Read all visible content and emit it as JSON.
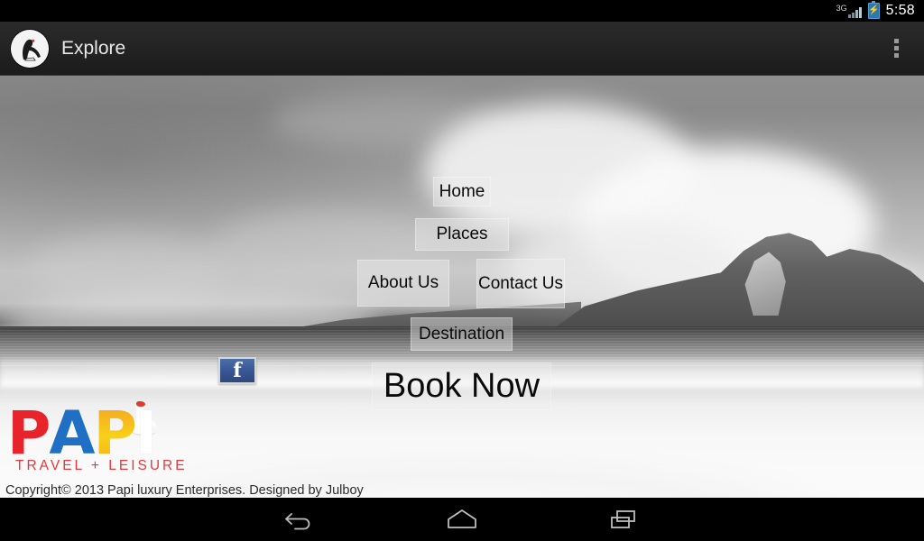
{
  "status_bar": {
    "network_label": "3G",
    "network_icon": "signal-bars-icon",
    "battery_icon": "battery-charging-icon",
    "battery_bolt": "⚡",
    "time": "5:58"
  },
  "action_bar": {
    "app_icon": "pelican-logo-icon",
    "title": "Explore",
    "overflow_icon": "overflow-menu-icon"
  },
  "page": {
    "background_image": "grayscale-beach-photo",
    "pelican_icon": "pelican-bird-icon"
  },
  "nav_buttons": [
    {
      "id": "home",
      "label": "Home"
    },
    {
      "id": "places",
      "label": "Places"
    },
    {
      "id": "about",
      "label": "About Us"
    },
    {
      "id": "contact",
      "label": "Contact Us"
    },
    {
      "id": "destination",
      "label": "Destination"
    },
    {
      "id": "book",
      "label": "Book Now"
    }
  ],
  "logo": {
    "letters": [
      "P",
      "A",
      "P",
      "I"
    ],
    "tagline": "TRAVEL + LEISURE",
    "colors": {
      "p1": "#e8232a",
      "a": "#1f6fc4",
      "p2": "#f5c21a",
      "i": "#ffffff",
      "tagline": "#e8383c"
    }
  },
  "social": {
    "facebook_icon": "facebook-icon",
    "facebook_glyph": "f"
  },
  "footer": {
    "copyright": "Copyright© 2013 Papi luxury Enterprises. Designed by Julboy"
  },
  "system_nav": {
    "back_icon": "back-arrow-icon",
    "home_icon": "home-icon",
    "recents_icon": "recent-apps-icon"
  }
}
